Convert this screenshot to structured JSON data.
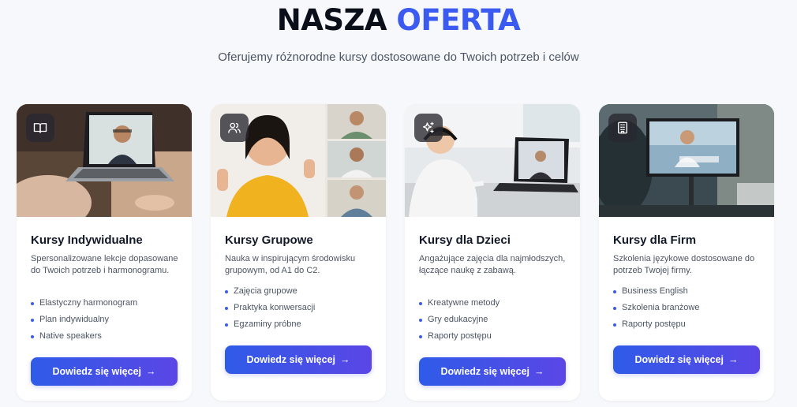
{
  "header": {
    "title_part1": "NASZA",
    "title_part2": "OFERTA",
    "subtitle": "Oferujemy różnorodne kursy dostosowane do Twoich potrzeb i celów"
  },
  "colors": {
    "accent": "#3b5bf0",
    "button_start": "#2f5be8",
    "button_end": "#5b46e6"
  },
  "cards": [
    {
      "icon": "book-icon",
      "title": "Kursy Indywidualne",
      "description": "Spersonalizowane lekcje dopasowane do Twoich potrzeb i harmonogramu.",
      "features": [
        "Elastyczny harmonogram",
        "Plan indywidualny",
        "Native speakers"
      ],
      "button_label": "Dowiedz się więcej",
      "button_arrow": "→"
    },
    {
      "icon": "users-icon",
      "title": "Kursy Grupowe",
      "description": "Nauka w inspirującym środowisku grupowym, od A1 do C2.",
      "features": [
        "Zajęcia grupowe",
        "Praktyka konwersacji",
        "Egzaminy próbne"
      ],
      "button_label": "Dowiedz się więcej",
      "button_arrow": "→"
    },
    {
      "icon": "sparkles-icon",
      "title": "Kursy dla Dzieci",
      "description": "Angażujące zajęcia dla najmłodszych, łączące naukę z zabawą.",
      "features": [
        "Kreatywne metody",
        "Gry edukacyjne",
        "Raporty postępu"
      ],
      "button_label": "Dowiedz się więcej",
      "button_arrow": "→"
    },
    {
      "icon": "building-icon",
      "title": "Kursy dla Firm",
      "description": "Szkolenia językowe dostosowane do potrzeb Twojej firmy.",
      "features": [
        "Business English",
        "Szkolenia branżowe",
        "Raporty postępu"
      ],
      "button_label": "Dowiedz się więcej",
      "button_arrow": "→"
    }
  ]
}
